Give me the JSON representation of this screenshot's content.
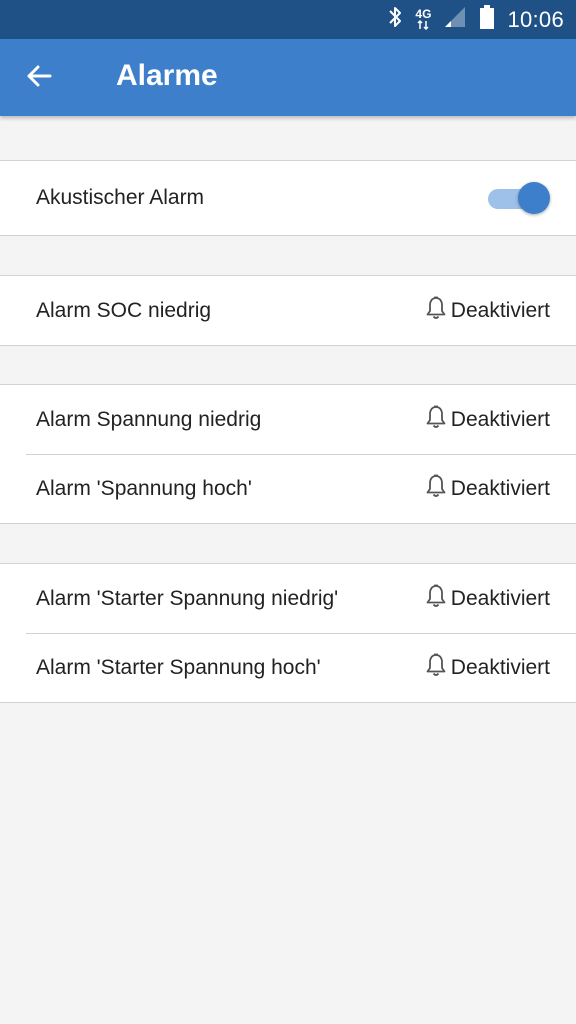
{
  "status_bar": {
    "time": "10:06",
    "network": "4G",
    "icons": [
      "bluetooth-icon",
      "network-4g-icon",
      "signal-icon",
      "battery-icon"
    ]
  },
  "app_bar": {
    "title": "Alarme",
    "back_icon": "arrow-left-icon"
  },
  "colors": {
    "status_bar": "#1f5187",
    "app_bar": "#3d7fca",
    "toggle_on": "#3d7fca",
    "background": "#f4f4f4"
  },
  "groups": [
    {
      "rows": [
        {
          "label": "Akustischer Alarm",
          "toggle_on": true
        }
      ]
    },
    {
      "rows": [
        {
          "label": "Alarm SOC niedrig",
          "status": "Deaktiviert"
        }
      ]
    },
    {
      "rows": [
        {
          "label": "Alarm Spannung niedrig",
          "status": "Deaktiviert"
        },
        {
          "label": "Alarm 'Spannung hoch'",
          "status": "Deaktiviert"
        }
      ]
    },
    {
      "rows": [
        {
          "label": "Alarm 'Starter Spannung niedrig'",
          "status": "Deaktiviert"
        },
        {
          "label": "Alarm 'Starter Spannung hoch'",
          "status": "Deaktiviert"
        }
      ]
    }
  ]
}
